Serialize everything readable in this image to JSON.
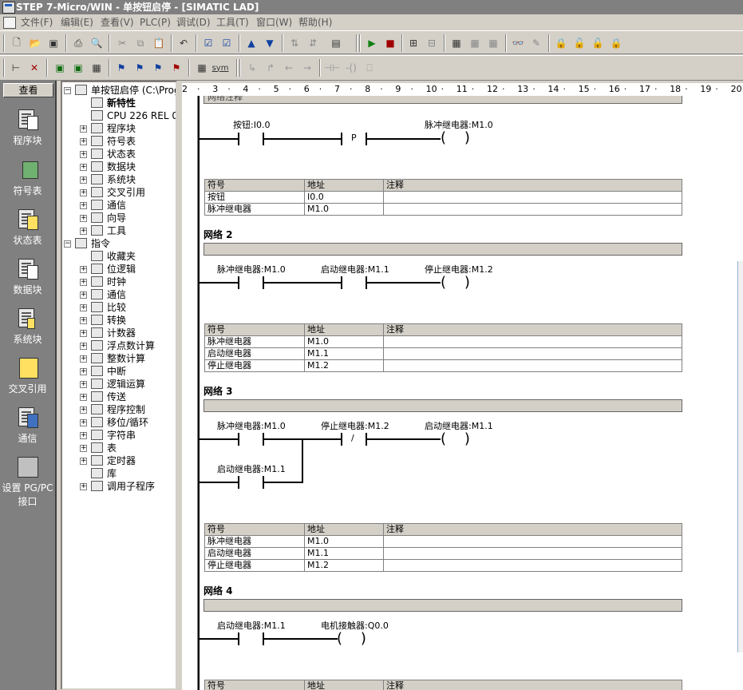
{
  "window": {
    "title": "STEP 7-Micro/WIN - 单按钮启停 - [SIMATIC LAD]"
  },
  "menu": [
    "文件(F)",
    "编辑(E)",
    "查看(V)",
    "PLC(P)",
    "调试(D)",
    "工具(T)",
    "窗口(W)",
    "帮助(H)"
  ],
  "toolbar2": {
    "sym_label": "sym"
  },
  "left_bar": {
    "header": "查看",
    "items": [
      {
        "label": "程序块"
      },
      {
        "label": "符号表"
      },
      {
        "label": "状态表"
      },
      {
        "label": "数据块"
      },
      {
        "label": "系统块"
      },
      {
        "label": "交叉引用"
      },
      {
        "label": "通信"
      },
      {
        "label": "设置 PG/PC",
        "label2": "接口"
      }
    ]
  },
  "tree": {
    "root": "单按钮启停 (C:\\Progr",
    "items": [
      "新特性",
      "CPU 226 REL 02.",
      "程序块",
      "符号表",
      "状态表",
      "数据块",
      "系统块",
      "交叉引用",
      "通信",
      "向导",
      "工具"
    ],
    "instructions": "指令",
    "inst_items": [
      "收藏夹",
      "位逻辑",
      "时钟",
      "通信",
      "比较",
      "转换",
      "计数器",
      "浮点数计算",
      "整数计算",
      "中断",
      "逻辑运算",
      "传送",
      "程序控制",
      "移位/循环",
      "字符串",
      "表",
      "定时器",
      "库",
      "调用子程序"
    ]
  },
  "ruler": [
    "2",
    "3",
    "4",
    "5",
    "6",
    "7",
    "8",
    "9",
    "10",
    "11",
    "12",
    "13",
    "14",
    "15",
    "16",
    "17",
    "18",
    "19",
    "20"
  ],
  "editor": {
    "top_comment": "网络注释",
    "sym_headers": [
      "符号",
      "地址",
      "注释"
    ],
    "n1": {
      "labels": [
        "按钮:I0.0",
        "脉冲继电器:M1.0"
      ],
      "p_label": "P",
      "rows": [
        [
          "按钮",
          "I0.0",
          ""
        ],
        [
          "脉冲继电器",
          "M1.0",
          ""
        ]
      ]
    },
    "n2": {
      "title": "网络 2",
      "labels": [
        "脉冲继电器:M1.0",
        "启动继电器:M1.1",
        "停止继电器:M1.2"
      ],
      "rows": [
        [
          "脉冲继电器",
          "M1.0",
          ""
        ],
        [
          "启动继电器",
          "M1.1",
          ""
        ],
        [
          "停止继电器",
          "M1.2",
          ""
        ]
      ]
    },
    "n3": {
      "title": "网络 3",
      "labels": [
        "脉冲继电器:M1.0",
        "停止继电器:M1.2",
        "启动继电器:M1.1",
        "启动继电器:M1.1"
      ],
      "rows": [
        [
          "脉冲继电器",
          "M1.0",
          ""
        ],
        [
          "启动继电器",
          "M1.1",
          ""
        ],
        [
          "停止继电器",
          "M1.2",
          ""
        ]
      ]
    },
    "n4": {
      "title": "网络 4",
      "labels": [
        "启动继电器:M1.1",
        "电机接触器:Q0.0"
      ]
    }
  }
}
